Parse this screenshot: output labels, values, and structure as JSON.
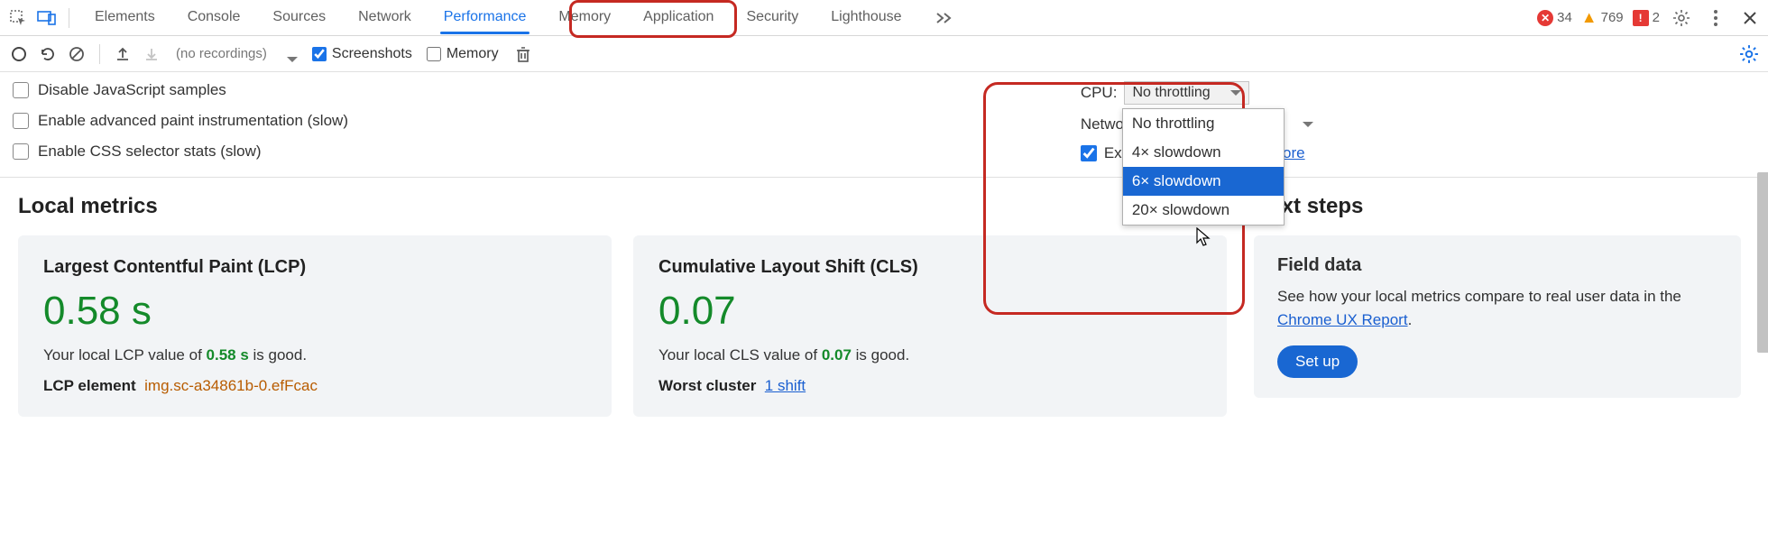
{
  "tabs": [
    "Elements",
    "Console",
    "Sources",
    "Network",
    "Performance",
    "Memory",
    "Application",
    "Security",
    "Lighthouse"
  ],
  "active_tab_index": 4,
  "badges": {
    "errors": "34",
    "warnings": "769",
    "issues": "2"
  },
  "toolbar": {
    "recordings_placeholder": "(no recordings)",
    "screenshots": "Screenshots",
    "memory": "Memory"
  },
  "settings": {
    "disable_js": "Disable JavaScript samples",
    "enable_paint": "Enable advanced paint instrumentation (slow)",
    "enable_css": "Enable CSS selector stats (slow)",
    "cpu_label": "CPU:",
    "cpu_value": "No throttling",
    "network_label": "Netwo",
    "extensions_prefix": "Ex",
    "learn_more": "n more",
    "cpu_options": [
      "No throttling",
      "4× slowdown",
      "6× slowdown",
      "20× slowdown"
    ]
  },
  "local": {
    "title": "Local metrics",
    "lcp": {
      "title": "Largest Contentful Paint (LCP)",
      "value": "0.58 s",
      "desc_prefix": "Your local LCP value of ",
      "desc_value": "0.58 s",
      "desc_suffix": " is good.",
      "sub_label": "LCP element",
      "sub_value": "img.sc-a34861b-0.efFcac"
    },
    "cls": {
      "title": "Cumulative Layout Shift (CLS)",
      "value": "0.07",
      "desc_prefix": "Your local CLS value of ",
      "desc_value": "0.07",
      "desc_suffix": " is good.",
      "sub_label": "Worst cluster",
      "sub_link": "1 shift"
    }
  },
  "next": {
    "title": "Next steps",
    "field_title": "Field data",
    "field_desc_prefix": "See how your local metrics compare to real user data in the ",
    "field_link": "Chrome UX Report",
    "setup": "Set up"
  }
}
